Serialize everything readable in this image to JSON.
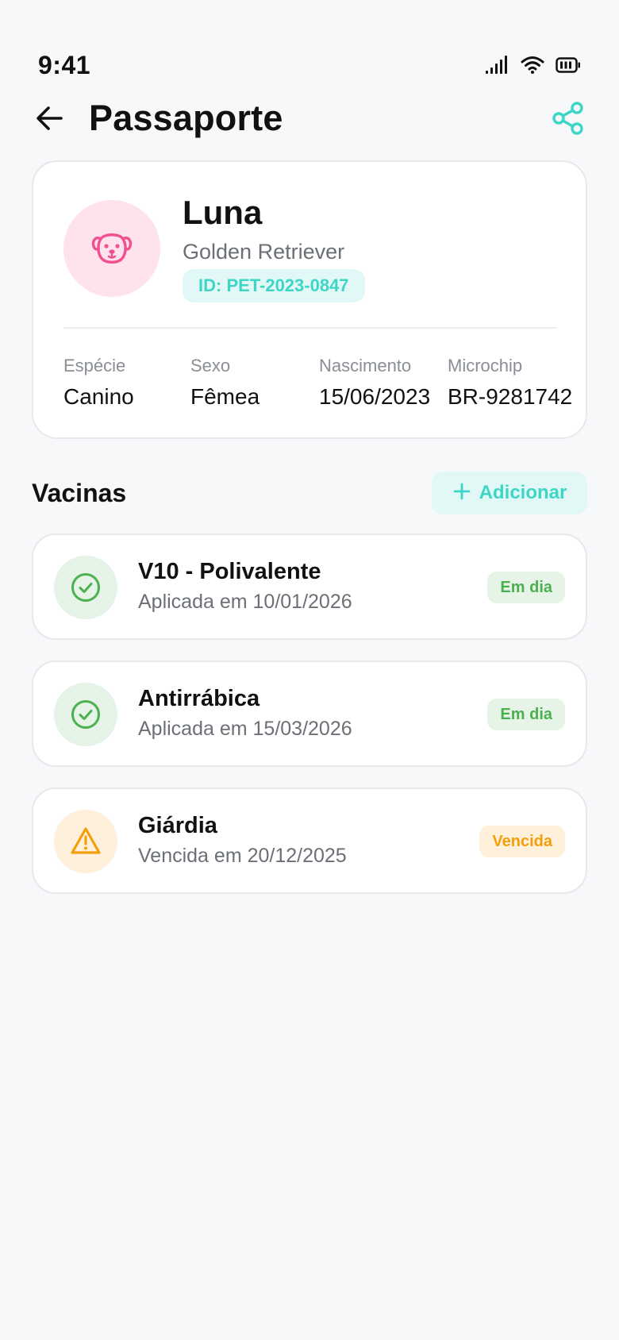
{
  "status_bar": {
    "time": "9:41",
    "icons": [
      "signal-icon",
      "wifi-icon",
      "battery-icon"
    ]
  },
  "header": {
    "title": "Passaporte",
    "back_icon": "arrow-left-icon",
    "share_icon": "share-icon"
  },
  "pet": {
    "name": "Luna",
    "breed": "Golden Retriever",
    "id_badge": "ID: PET-2023-0847",
    "avatar_icon": "dog-face-icon",
    "details": [
      {
        "label": "Espécie",
        "value": "Canino"
      },
      {
        "label": "Sexo",
        "value": "Fêmea"
      },
      {
        "label": "Nascimento",
        "value": "15/06/2023"
      },
      {
        "label": "Microchip",
        "value": "BR-9281742"
      }
    ]
  },
  "vaccines_section": {
    "title": "Vacinas",
    "add_label": "Adicionar",
    "items": [
      {
        "name": "V10 - Polivalente",
        "date": "Aplicada em 10/01/2026",
        "status": "Em dia",
        "icon": "check-circle-icon"
      },
      {
        "name": "Antirrábica",
        "date": "Aplicada em 15/03/2026",
        "status": "Em dia",
        "icon": "check-circle-icon"
      },
      {
        "name": "Giárdia",
        "date": "Vencida em 20/12/2025",
        "status": "Vencida",
        "icon": "warning-triangle-icon"
      }
    ]
  },
  "colors": {
    "accent": "#3dd6c6",
    "ok": "#4caf50",
    "warning": "#f59e0b",
    "avatar_bg": "#ffe3ec",
    "avatar_icon": "#f0508f"
  }
}
